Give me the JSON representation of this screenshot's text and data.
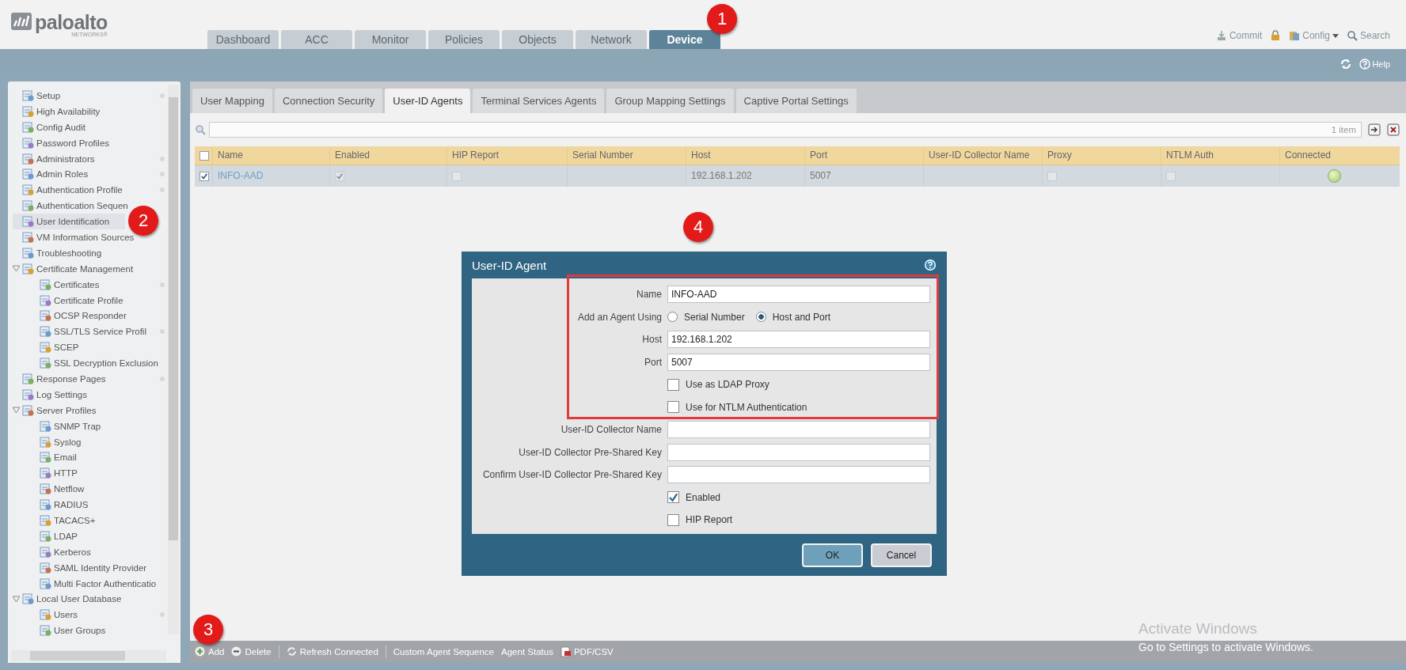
{
  "header": {
    "logo": {
      "name": "paloalto",
      "tagline": "NETWORKS®"
    },
    "tabs": [
      {
        "label": "Dashboard",
        "selected": false
      },
      {
        "label": "ACC",
        "selected": false
      },
      {
        "label": "Monitor",
        "selected": false
      },
      {
        "label": "Policies",
        "selected": false
      },
      {
        "label": "Objects",
        "selected": false
      },
      {
        "label": "Network",
        "selected": false
      },
      {
        "label": "Device",
        "selected": true
      }
    ],
    "actions": [
      {
        "kind": "commit",
        "label": "Commit"
      },
      {
        "kind": "lock"
      },
      {
        "kind": "config",
        "label": "Config"
      },
      {
        "kind": "search",
        "label": "Search"
      }
    ]
  },
  "subbar": {
    "actions": [
      {
        "kind": "refresh"
      },
      {
        "kind": "help",
        "label": "Help"
      }
    ]
  },
  "sidebar": {
    "items": [
      {
        "label": "Setup",
        "dot": true,
        "selected": false
      },
      {
        "label": "High Availability",
        "dot": false,
        "selected": false
      },
      {
        "label": "Config Audit",
        "dot": false,
        "selected": false
      },
      {
        "label": "Password Profiles",
        "dot": false,
        "selected": false
      },
      {
        "label": "Administrators",
        "dot": true,
        "selected": false
      },
      {
        "label": "Admin Roles",
        "dot": true,
        "selected": false
      },
      {
        "label": "Authentication Profile",
        "dot": true,
        "selected": false
      },
      {
        "label": "Authentication Sequen",
        "dot": false,
        "selected": false
      },
      {
        "label": "User Identification",
        "dot": false,
        "selected": true
      },
      {
        "label": "VM Information Sources",
        "dot": false,
        "selected": false
      },
      {
        "label": "Troubleshooting",
        "dot": false,
        "selected": false
      },
      {
        "label": "Certificate Management",
        "dot": false,
        "selected": false,
        "expanded": true,
        "children": [
          {
            "label": "Certificates",
            "dot": true,
            "selected": false
          },
          {
            "label": "Certificate Profile",
            "dot": false,
            "selected": false
          },
          {
            "label": "OCSP Responder",
            "dot": false,
            "selected": false
          },
          {
            "label": "SSL/TLS Service Profil",
            "dot": true,
            "selected": false
          },
          {
            "label": "SCEP",
            "dot": false,
            "selected": false
          },
          {
            "label": "SSL Decryption Exclusion",
            "dot": false,
            "selected": false
          }
        ]
      },
      {
        "label": "Response Pages",
        "dot": true,
        "selected": false
      },
      {
        "label": "Log Settings",
        "dot": false,
        "selected": false
      },
      {
        "label": "Server Profiles",
        "dot": false,
        "selected": false,
        "expanded": true,
        "children": [
          {
            "label": "SNMP Trap",
            "dot": false,
            "selected": false
          },
          {
            "label": "Syslog",
            "dot": false,
            "selected": false
          },
          {
            "label": "Email",
            "dot": false,
            "selected": false
          },
          {
            "label": "HTTP",
            "dot": false,
            "selected": false
          },
          {
            "label": "Netflow",
            "dot": false,
            "selected": false
          },
          {
            "label": "RADIUS",
            "dot": false,
            "selected": false
          },
          {
            "label": "TACACS+",
            "dot": false,
            "selected": false
          },
          {
            "label": "LDAP",
            "dot": false,
            "selected": false
          },
          {
            "label": "Kerberos",
            "dot": false,
            "selected": false
          },
          {
            "label": "SAML Identity Provider",
            "dot": false,
            "selected": false
          },
          {
            "label": "Multi Factor Authenticatio",
            "dot": false,
            "selected": false
          }
        ]
      },
      {
        "label": "Local User Database",
        "dot": false,
        "selected": false,
        "expanded": true,
        "children": [
          {
            "label": "Users",
            "dot": true,
            "selected": false
          },
          {
            "label": "User Groups",
            "dot": false,
            "selected": false
          }
        ]
      }
    ]
  },
  "subtabs": [
    {
      "label": "User Mapping",
      "selected": false
    },
    {
      "label": "Connection Security",
      "selected": false
    },
    {
      "label": "User-ID Agents",
      "selected": true
    },
    {
      "label": "Terminal Services Agents",
      "selected": false
    },
    {
      "label": "Group Mapping Settings",
      "selected": false
    },
    {
      "label": "Captive Portal Settings",
      "selected": false
    }
  ],
  "filter": {
    "count": "1 item"
  },
  "table": {
    "header_checked": false,
    "columns": [
      "Name",
      "Enabled",
      "HIP Report",
      "Serial Number",
      "Host",
      "Port",
      "User-ID Collector Name",
      "Proxy",
      "NTLM Auth",
      "Connected"
    ],
    "rows": [
      {
        "selected": true,
        "name": "INFO-AAD",
        "enabled": true,
        "hip_report": false,
        "serial_number": "",
        "host": "192.168.1.202",
        "port": "5007",
        "collector_name": "",
        "proxy": false,
        "ntlm_auth": false,
        "connected": true
      }
    ]
  },
  "toolbar": [
    {
      "kind": "add",
      "label": "Add"
    },
    {
      "kind": "delete",
      "label": "Delete"
    },
    {
      "kind": "refresh",
      "label": "Refresh Connected"
    },
    {
      "kind": "text",
      "label": "Custom Agent Sequence"
    },
    {
      "kind": "text",
      "label": "Agent Status"
    },
    {
      "kind": "pdf",
      "label": "PDF/CSV"
    }
  ],
  "dialog": {
    "title": "User-ID Agent",
    "rows": [
      {
        "kind": "text",
        "label": "Name",
        "value": "INFO-AAD"
      },
      {
        "kind": "radio",
        "label": "Add an Agent Using",
        "options": [
          {
            "label": "Serial Number",
            "selected": false
          },
          {
            "label": "Host and Port",
            "selected": true
          }
        ]
      },
      {
        "kind": "text",
        "label": "Host",
        "value": "192.168.1.202"
      },
      {
        "kind": "text",
        "label": "Port",
        "value": "5007"
      },
      {
        "kind": "checkbox",
        "label": "Use as LDAP Proxy",
        "checked": false
      },
      {
        "kind": "checkbox",
        "label": "Use for NTLM Authentication",
        "checked": false
      },
      {
        "kind": "text",
        "label": "User-ID Collector Name"
      },
      {
        "kind": "text",
        "label": "User-ID Collector Pre-Shared Key"
      },
      {
        "kind": "text",
        "label": "Confirm User-ID Collector Pre-Shared Key"
      },
      {
        "kind": "checkbox",
        "label": "Enabled",
        "checked": true
      },
      {
        "kind": "checkbox",
        "label": "HIP Report",
        "checked": false
      }
    ],
    "buttons": [
      {
        "label": "OK",
        "kind": "primary"
      },
      {
        "label": "Cancel",
        "kind": "secondary"
      }
    ]
  },
  "annotations": [
    "1",
    "2",
    "3",
    "4"
  ],
  "os_notice": {
    "title": "Activate Windows",
    "text": "Go to Settings to activate Windows."
  }
}
